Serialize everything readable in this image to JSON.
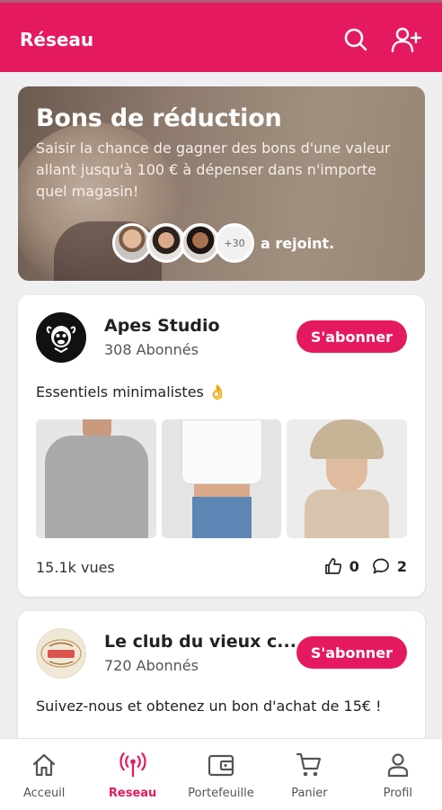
{
  "header": {
    "title": "Réseau"
  },
  "promo": {
    "title": "Bons de réduction",
    "description": "Saisir la chance de gagner des bons d'une valeur allant jusqu'à 100 € à dépenser dans n'importe quel magasin!",
    "more_count": "+30",
    "joined_text": "a rejoint."
  },
  "posts": [
    {
      "name": "Apes Studio",
      "followers": "308 Abonnés",
      "subscribe_label": "S'abonner",
      "text": "Essentiels minimalistes 👌",
      "views": "15.1k vues",
      "likes": "0",
      "comments": "2"
    },
    {
      "name": "Le club du vieux c...",
      "followers": "720 Abonnés",
      "subscribe_label": "S'abonner",
      "text": "Suivez-nous et obtenez un bon d'achat de 15€ !"
    }
  ],
  "nav": [
    {
      "label": "Acceuil",
      "icon": "home-icon"
    },
    {
      "label": "Reseau",
      "icon": "network-icon",
      "active": true
    },
    {
      "label": "Portefeuille",
      "icon": "wallet-icon"
    },
    {
      "label": "Panier",
      "icon": "cart-icon"
    },
    {
      "label": "Profil",
      "icon": "profile-icon"
    }
  ],
  "colors": {
    "accent": "#e5195f",
    "background": "#efeff1",
    "card": "#ffffff"
  }
}
